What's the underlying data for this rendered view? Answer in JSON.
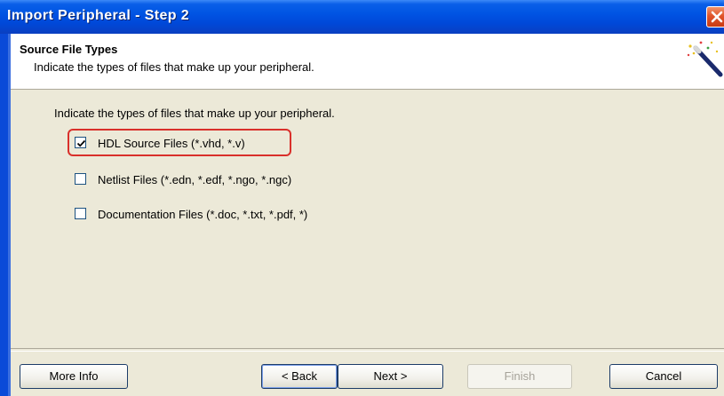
{
  "window": {
    "title": "Import Peripheral - Step 2"
  },
  "header": {
    "title": "Source File Types",
    "subtitle": "Indicate the types of files that make up your peripheral."
  },
  "main": {
    "instruction": "Indicate the types of files that make up your peripheral.",
    "options": [
      {
        "label": "HDL Source Files (*.vhd, *.v)",
        "checked": true
      },
      {
        "label": "Netlist Files (*.edn, *.edf, *.ngo, *.ngc)",
        "checked": false
      },
      {
        "label": "Documentation Files (*.doc, *.txt, *.pdf, *)",
        "checked": false
      }
    ]
  },
  "buttons": {
    "more_info": "More Info",
    "back": "< Back",
    "next": "Next >",
    "finish": "Finish",
    "cancel": "Cancel"
  },
  "colors": {
    "titlebar": "#0054e3",
    "highlight": "#d9302b",
    "dialog_bg": "#ece9d8"
  }
}
